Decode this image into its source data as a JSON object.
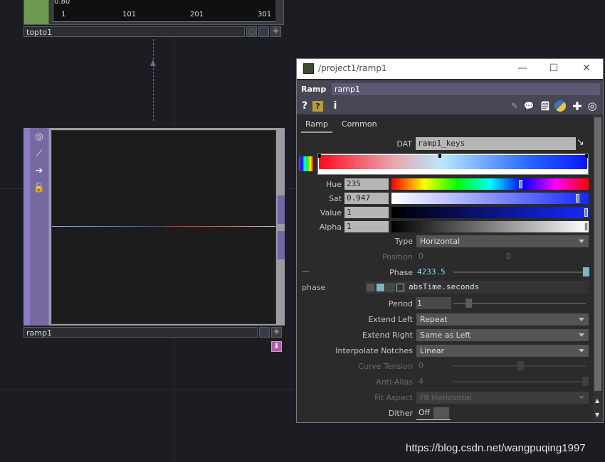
{
  "network": {
    "top_node": {
      "name": "topto1",
      "y_label": "0.80",
      "x_ticks": [
        "1",
        "101",
        "201",
        "301"
      ]
    },
    "ramp_node": {
      "name": "ramp1"
    }
  },
  "param_window": {
    "title": "/project1/ramp1",
    "window_buttons": {
      "minimize": "—",
      "maximize": "☐",
      "close": "✕"
    },
    "op_type": "Ramp",
    "op_name": "ramp1",
    "tabs": [
      {
        "label": "Ramp",
        "active": true
      },
      {
        "label": "Common",
        "active": false
      }
    ],
    "params": {
      "dat": {
        "label": "DAT",
        "value": "ramp1_keys"
      },
      "hue": {
        "label": "Hue",
        "value": "235",
        "level": 0.65
      },
      "sat": {
        "label": "Sat",
        "value": "0.947",
        "level": 0.947
      },
      "val": {
        "label": "Value",
        "value": "1",
        "level": 1
      },
      "alpha": {
        "label": "Alpha",
        "value": "1",
        "level": 1
      },
      "type": {
        "label": "Type",
        "value": "Horizontal"
      },
      "position": {
        "label": "Position",
        "value1": "0",
        "value2": "0"
      },
      "phase": {
        "label": "Phase",
        "value": "4233.5",
        "collapse": "—",
        "expr_name": "phase",
        "expr": "absTime.seconds"
      },
      "period": {
        "label": "Period",
        "value": "1"
      },
      "extend_left": {
        "label": "Extend Left",
        "value": "Repeat"
      },
      "extend_right": {
        "label": "Extend Right",
        "value": "Same as Left"
      },
      "interp": {
        "label": "Interpolate Notches",
        "value": "Linear"
      },
      "curve_tension": {
        "label": "Curve Tension",
        "value": "0"
      },
      "anti_alias": {
        "label": "Anti-Alias",
        "value": "4"
      },
      "fit_aspect": {
        "label": "Fit Aspect",
        "value": "Fit Horizontal"
      },
      "dither": {
        "label": "Dither",
        "value": "Off"
      }
    }
  },
  "watermark": "https://blog.csdn.net/wangpuqing1997",
  "colors": {
    "ramp_node": "#8a7cc2",
    "topto_node": "#6e9a4f",
    "header": "#464655"
  }
}
